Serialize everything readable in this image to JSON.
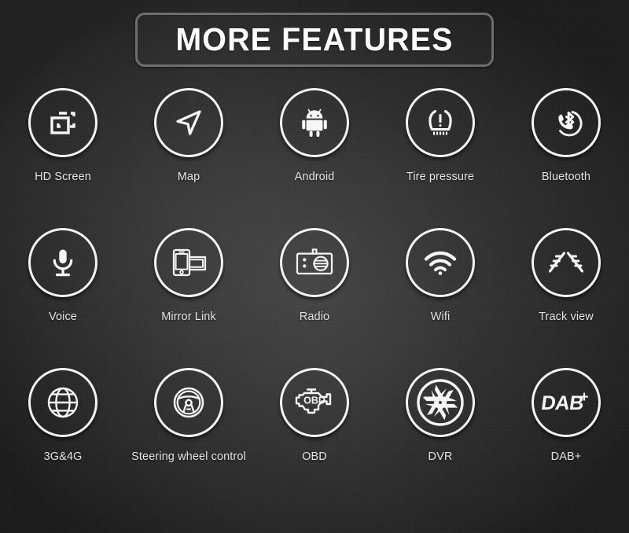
{
  "header": {
    "title": "MORE FEATURES"
  },
  "theme": {
    "background_dark": "#242424",
    "background_center": "#434343",
    "icon_stroke": "#f4f4f4",
    "label_color": "#e4e4e4",
    "title_border": "#7a7a7a"
  },
  "features": [
    {
      "label": "HD Screen",
      "icon": "hd-screen-icon"
    },
    {
      "label": "Map",
      "icon": "navigation-arrow-icon"
    },
    {
      "label": "Android",
      "icon": "android-robot-icon"
    },
    {
      "label": "Tire pressure",
      "icon": "tire-pressure-icon"
    },
    {
      "label": "Bluetooth",
      "icon": "bluetooth-phone-icon"
    },
    {
      "label": "Voice",
      "icon": "microphone-icon"
    },
    {
      "label": "Mirror Link",
      "icon": "mirror-link-icon"
    },
    {
      "label": "Radio",
      "icon": "radio-icon"
    },
    {
      "label": "Wifi",
      "icon": "wifi-icon"
    },
    {
      "label": "Track view",
      "icon": "track-view-icon"
    },
    {
      "label": "3G&4G",
      "icon": "globe-icon"
    },
    {
      "label": "Steering wheel control",
      "icon": "steering-wheel-icon"
    },
    {
      "label": "OBD",
      "icon": "obd-engine-icon"
    },
    {
      "label": "DVR",
      "icon": "aperture-icon"
    },
    {
      "label": "DAB+",
      "icon": "dab-plus-icon"
    }
  ],
  "icon_text": {
    "obd": "OBD",
    "dab": "DAB",
    "dab_plus": "+"
  }
}
